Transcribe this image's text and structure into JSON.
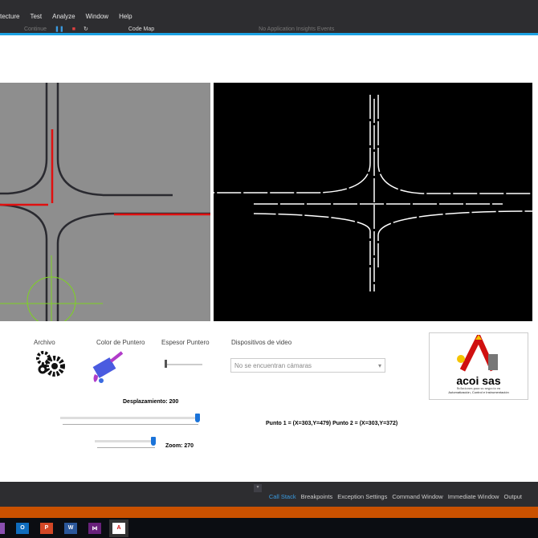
{
  "menu": [
    "tecture",
    "Test",
    "Analyze",
    "Window",
    "Help"
  ],
  "toolbar": {
    "continue": "Continue",
    "code_map": "Code Map",
    "insights": "No Application Insights Events"
  },
  "controls": {
    "archivo": "Archivo",
    "color_puntero": "Color de Puntero",
    "espesor_puntero": "Espesor Puntero",
    "dispositivos": "Dispositivos de video",
    "combo_value": "No se encuentran cámaras",
    "desplazamiento": "Desplazamiento: 200",
    "zoom": "Zoom: 270",
    "puntos": "Punto 1 = (X=303,Y=479) Punto 2 = (X=303,Y=372)",
    "espesor_level": 0,
    "desplazamiento_level": 1.0,
    "zoom_level": 1.0
  },
  "logo": {
    "name": "acoi sas",
    "tagline1": "Soluciones para su negocio en",
    "tagline2": "Automatización, Control e Instrumentación"
  },
  "bottom_tabs": [
    "Call Stack",
    "Breakpoints",
    "Exception Settings",
    "Command Window",
    "Immediate Window",
    "Output"
  ],
  "taskbar": [
    "onenote",
    "outlook",
    "powerpoint",
    "word",
    "visual-studio",
    "acoi-app"
  ],
  "colors": {
    "accent": "#1ba1e2",
    "orange": "#ca5100",
    "pointer": "#e01010",
    "crosshair": "#7ed321"
  }
}
